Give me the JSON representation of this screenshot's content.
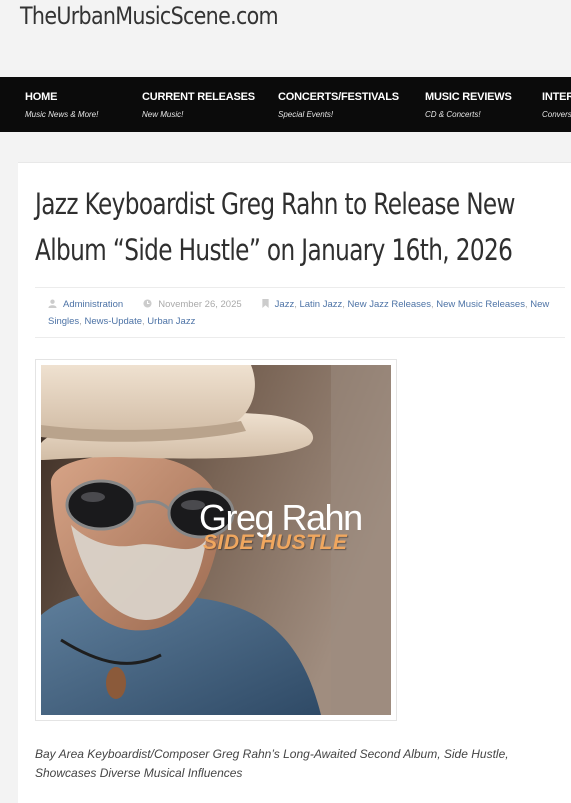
{
  "site": {
    "title": "TheUrbanMusicScene.com"
  },
  "nav": [
    {
      "label": "HOME",
      "sub": "Music News & More!"
    },
    {
      "label": "CURRENT RELEASES",
      "sub": "New Music!"
    },
    {
      "label": "CONCERTS/FESTIVALS",
      "sub": "Special Events!"
    },
    {
      "label": "MUSIC REVIEWS",
      "sub": "CD & Concerts!"
    },
    {
      "label": "INTER",
      "sub": "Convers"
    }
  ],
  "post": {
    "title": "Jazz Keyboardist Greg Rahn to Release New Album “Side Hustle” on January 16th, 2026",
    "author": "Administration",
    "date": "November 26, 2025",
    "categories": [
      "Jazz",
      "Latin Jazz",
      "New Jazz Releases",
      "New Music Releases",
      "New Singles",
      "News-Update",
      "Urban Jazz"
    ],
    "separator": ", ",
    "icons": {
      "author": "user-icon",
      "date": "clock-icon",
      "categories": "bookmark-icon"
    },
    "cover": {
      "artist": "Greg Rahn",
      "album": "SIDE HUSTLE",
      "album_color": "#f0a75f"
    },
    "excerpt": "Bay Area Keyboardist/Composer Greg Rahn’s Long-Awaited Second Album, Side Hustle, Showcases Diverse Musical Influences"
  },
  "colors": {
    "nav_bg": "#0b0b0b",
    "link": "#4d73a6",
    "page_bg": "#f3f3f3"
  }
}
